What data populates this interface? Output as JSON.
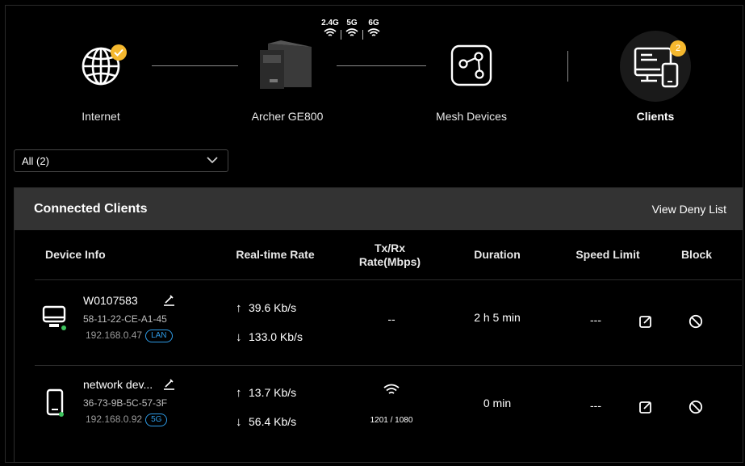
{
  "topology": {
    "internet": {
      "label": "Internet",
      "icon": "globe-icon",
      "status_icon": "check-badge-icon"
    },
    "router": {
      "label": "Archer GE800",
      "icon": "router-icon"
    },
    "wifi_bands": [
      "2.4G",
      "5G",
      "6G"
    ],
    "mesh": {
      "label": "Mesh Devices",
      "icon": "mesh-icon"
    },
    "clients": {
      "label": "Clients",
      "icon": "clients-icon",
      "badge_count": "2"
    }
  },
  "filter": {
    "value": "All (2)"
  },
  "panel": {
    "title": "Connected Clients",
    "deny_list_link": "View Deny List",
    "columns": {
      "device_info": "Device Info",
      "realtime_rate": "Real-time Rate",
      "txrx_line1": "Tx/Rx",
      "txrx_line2": "Rate(Mbps)",
      "duration": "Duration",
      "speed_limit": "Speed Limit",
      "block": "Block"
    },
    "rows": [
      {
        "name": "W0107583",
        "mac": "58-11-22-CE-A1-45",
        "ip": "192.168.0.47",
        "connection": "LAN",
        "device_icon": "desktop-icon",
        "upload": "39.6 Kb/s",
        "download": "133.0 Kb/s",
        "txrx": "--",
        "duration": "2 h 5 min",
        "speed_limit": "---"
      },
      {
        "name": "network dev...",
        "mac": "36-73-9B-5C-57-3F",
        "ip": "192.168.0.92",
        "connection": "5G",
        "device_icon": "phone-icon",
        "upload": "13.7 Kb/s",
        "download": "56.4 Kb/s",
        "txrx": "1201 / 1080",
        "duration": "0 min",
        "speed_limit": "---"
      }
    ]
  },
  "colors": {
    "accent_blue": "#2e9be6",
    "badge_yellow": "#f5b82e",
    "online_green": "#3ec45e",
    "header_gray": "#333333"
  }
}
